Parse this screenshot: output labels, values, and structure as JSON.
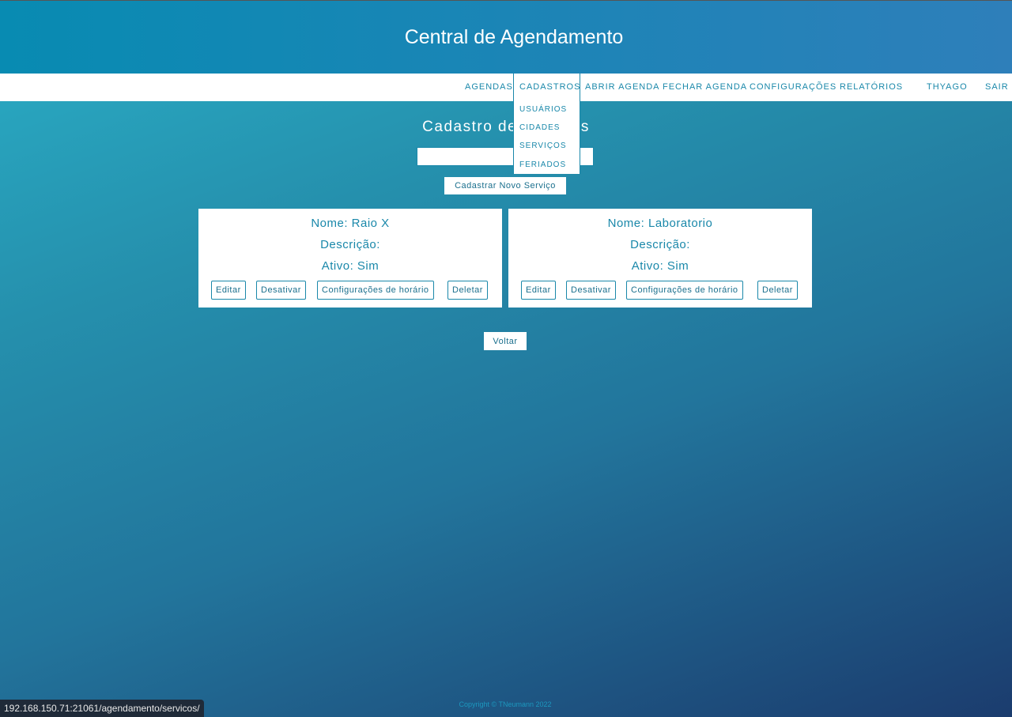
{
  "header": {
    "title": "Central de Agendamento"
  },
  "nav": {
    "items": [
      "AGENDAS",
      "CADASTROS",
      "ABRIR AGENDA",
      "FECHAR AGENDA",
      "CONFIGURAÇÕES",
      "RELATÓRIOS"
    ],
    "user": "THYAGO",
    "logout": "SAIR"
  },
  "dropdown": {
    "items": [
      "USUÁRIOS",
      "CIDADES",
      "SERVIÇOS",
      "FERIADOS"
    ]
  },
  "page": {
    "title": "Cadastro de Serviços",
    "search_value": "",
    "new_button": "Cadastrar Novo Serviço",
    "back_button": "Voltar"
  },
  "services": [
    {
      "name": "Nome: Raio X",
      "description": "Descrição:",
      "active": "Ativo: Sim"
    },
    {
      "name": "Nome: Laboratorio",
      "description": "Descrição:",
      "active": "Ativo: Sim"
    }
  ],
  "card_actions": {
    "edit": "Editar",
    "deactivate": "Desativar",
    "schedule": "Configurações de horário",
    "delete": "Deletar"
  },
  "footer": "Copyright © TNeumann 2022",
  "status_url": "192.168.150.71:21061/agendamento/servicos/"
}
